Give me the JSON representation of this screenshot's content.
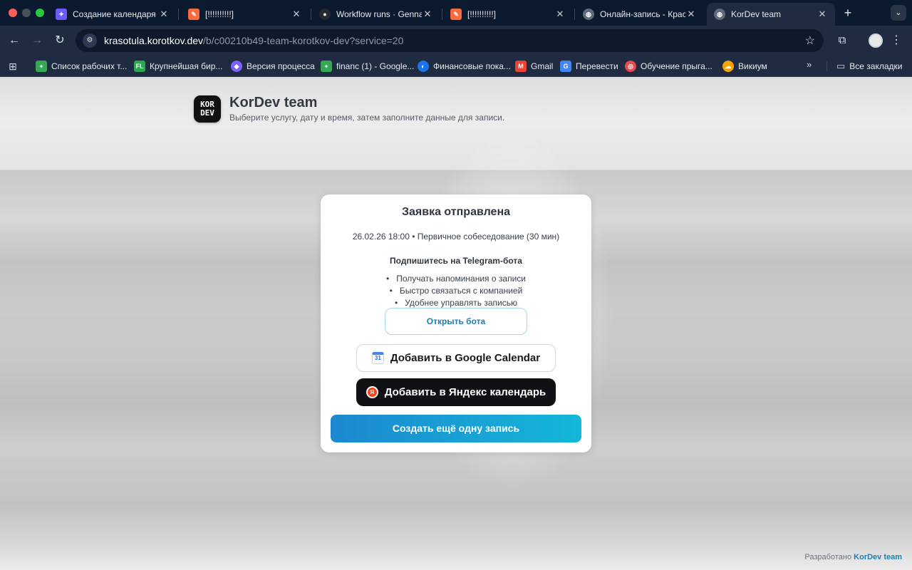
{
  "browser": {
    "tabs": [
      {
        "title": "Создание календаря с",
        "favicon": "cursor-logo-icon",
        "active": false
      },
      {
        "title": "[!!!!!!!!!!]",
        "favicon": "app-logo-icon",
        "active": false
      },
      {
        "title": "Workflow runs · Gennadi",
        "favicon": "github-icon",
        "active": false
      },
      {
        "title": "[!!!!!!!!!!]",
        "favicon": "app-logo-icon",
        "active": false
      },
      {
        "title": "Онлайн-запись - Красо",
        "favicon": "globe-icon",
        "active": false
      },
      {
        "title": "KorDev team",
        "favicon": "globe-icon",
        "active": true
      }
    ],
    "url_host": "krasotula.korotkov.dev",
    "url_path": "/b/c00210b49-team-korotkov-dev?service=20",
    "bookmarks": [
      {
        "label": "Список рабочих т...",
        "icon": "sheets-icon",
        "color": "#34a853"
      },
      {
        "label": "Крупнейшая бир...",
        "icon": "fl-icon",
        "color": "#2ea44f"
      },
      {
        "label": "Версия процесса",
        "icon": "process-icon",
        "color": "#7b61ff"
      },
      {
        "label": "financ (1) - Google...",
        "icon": "sheets-icon",
        "color": "#34a853"
      },
      {
        "label": "Финансовые пока...",
        "icon": "finance-icon",
        "color": "#1a73e8"
      },
      {
        "label": "Gmail",
        "icon": "gmail-icon",
        "color": "#ea4335"
      },
      {
        "label": "Перевести",
        "icon": "translate-icon",
        "color": "#4285f4"
      },
      {
        "label": "Обучение прыга...",
        "icon": "training-icon",
        "color": "#e5484d"
      },
      {
        "label": "Викиум",
        "icon": "wikium-icon",
        "color": "#f4a300"
      }
    ],
    "all_bookmarks": "Все закладки",
    "more": "»"
  },
  "header": {
    "logo_text": "KOR DEV",
    "title": "KorDev team",
    "subtitle": "Выберите услугу, дату и время, затем заполните данные для записи."
  },
  "card": {
    "title": "Заявка отправлена",
    "meta": "26.02.26 18:00 • Первичное собеседование (30 мин)",
    "telegram_heading": "Подпишитесь на Telegram-бота",
    "benefits": [
      "Получать напоминания о записи",
      "Быстро связаться с компанией",
      "Удобнее управлять записью"
    ],
    "open_bot": "Открыть бота",
    "google_calendar": "Добавить в Google Calendar",
    "google_calendar_day": "31",
    "yandex_calendar": "Добавить в Яндекс календарь",
    "yandex_letter": "Я",
    "create_another": "Создать ещё одну запись"
  },
  "footer": {
    "prefix": "Разработано",
    "link": "KorDev team"
  },
  "colors": {
    "tabbar": "#0c1a30",
    "toolbar": "#1e2b40",
    "accent": "#1b7fb3",
    "primary_button": "#1d88cf"
  }
}
